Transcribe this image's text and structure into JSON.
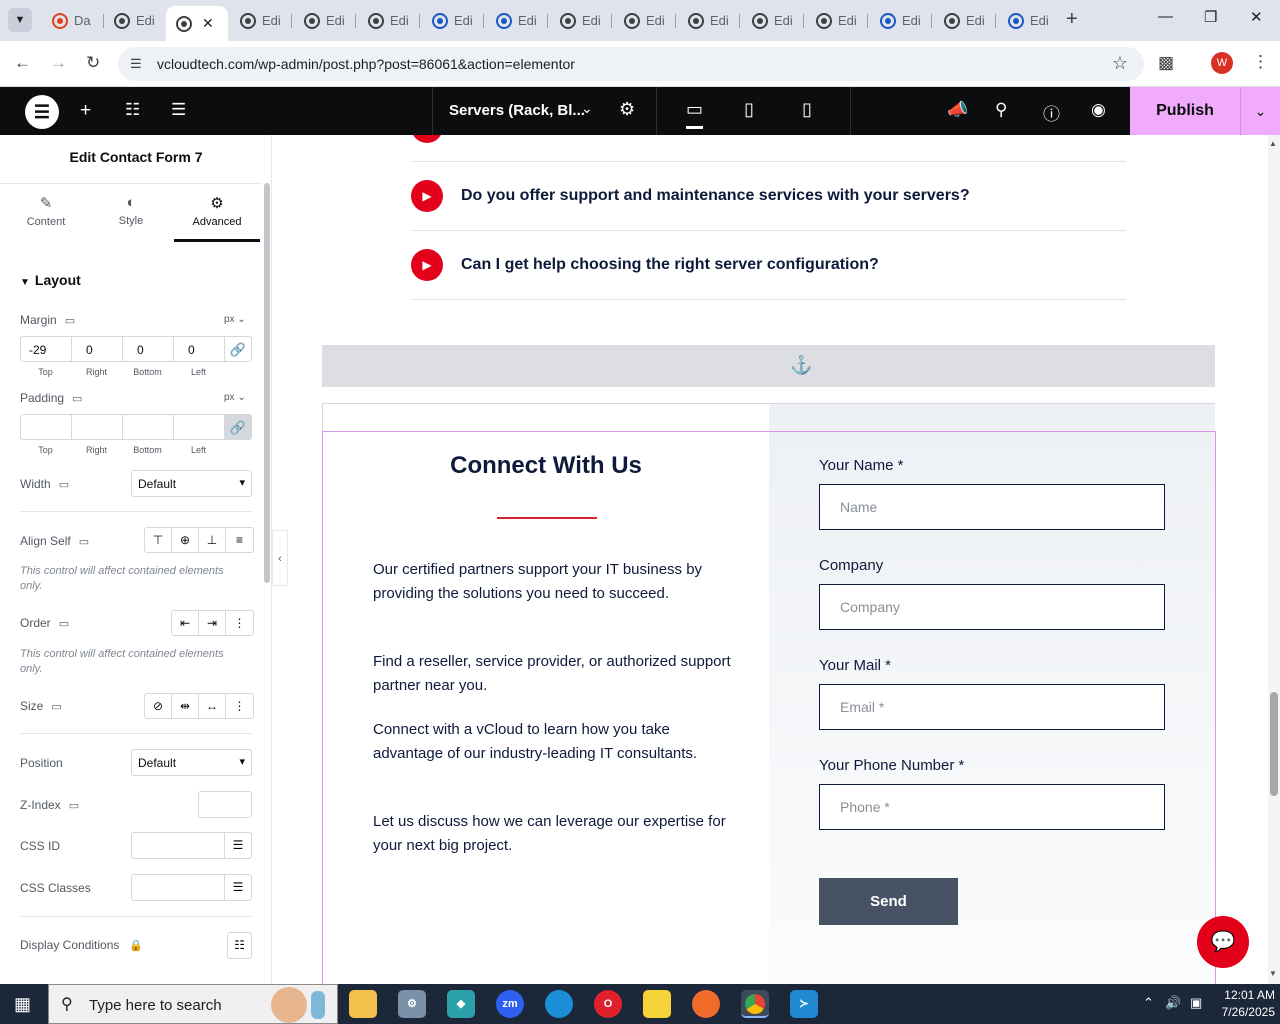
{
  "browser": {
    "tabs": [
      {
        "label": "Da",
        "favicon": "red"
      },
      {
        "label": "Edi",
        "favicon": "grey"
      },
      {
        "label": "",
        "favicon": "grey",
        "active": true
      },
      {
        "label": "Edi",
        "favicon": "grey"
      },
      {
        "label": "Edi",
        "favicon": "grey"
      },
      {
        "label": "Edi",
        "favicon": "grey"
      },
      {
        "label": "Edi",
        "favicon": "blue"
      },
      {
        "label": "Edi",
        "favicon": "blue"
      },
      {
        "label": "Edi",
        "favicon": "grey"
      },
      {
        "label": "Edi",
        "favicon": "grey"
      },
      {
        "label": "Edi",
        "favicon": "grey"
      },
      {
        "label": "Edi",
        "favicon": "grey"
      },
      {
        "label": "Edi",
        "favicon": "grey"
      },
      {
        "label": "Edi",
        "favicon": "blue"
      },
      {
        "label": "Edi",
        "favicon": "grey"
      },
      {
        "label": "Edi",
        "favicon": "blue"
      }
    ],
    "tab_close": "✕",
    "new_tab": "+",
    "url": "vcloudtech.com/wp-admin/post.php?post=86061&action=elementor",
    "profile_initial": "W"
  },
  "editor": {
    "document_title": "Servers (Rack, Bl...",
    "publish_label": "Publish",
    "accent_color": "#f0abfc"
  },
  "panel": {
    "title": "Edit Contact Form 7",
    "tabs": [
      "Content",
      "Style",
      "Advanced"
    ],
    "section": "Layout",
    "margin": {
      "label": "Margin",
      "unit": "px",
      "top": "-29",
      "right": "0",
      "bottom": "0",
      "left": "0"
    },
    "padding": {
      "label": "Padding",
      "unit": "px"
    },
    "sides": [
      "Top",
      "Right",
      "Bottom",
      "Left"
    ],
    "width": {
      "label": "Width",
      "value": "Default"
    },
    "align_self": {
      "label": "Align Self",
      "note": "This control will affect contained elements only."
    },
    "order": {
      "label": "Order",
      "note": "This control will affect contained elements only."
    },
    "size": {
      "label": "Size"
    },
    "position": {
      "label": "Position",
      "value": "Default"
    },
    "z_index": {
      "label": "Z-Index"
    },
    "css_id": {
      "label": "CSS ID"
    },
    "css_classes": {
      "label": "CSS Classes"
    },
    "display_conditions": {
      "label": "Display Conditions"
    }
  },
  "page": {
    "faq": [
      "Do you offer support and maintenance services with your servers?",
      "Can I get help choosing the right server configuration?"
    ],
    "connect": {
      "heading": "Connect With Us",
      "paragraphs": [
        "Our certified partners support your IT business by providing the solutions you need to succeed.",
        "Find a reseller, service provider, or authorized support partner near you.",
        "Connect with a vCloud to learn how you take advantage of our industry-leading IT consultants.",
        "Let us discuss how we can leverage our expertise for your next big project."
      ]
    },
    "form": {
      "fields": [
        {
          "label": "Your Name *",
          "placeholder": "Name"
        },
        {
          "label": "Company",
          "placeholder": "Company"
        },
        {
          "label": "Your Mail *",
          "placeholder": "Email *"
        },
        {
          "label": "Your Phone Number *",
          "placeholder": "Phone *"
        }
      ],
      "submit": "Send"
    },
    "brand_red": "#e3001b"
  },
  "taskbar": {
    "search_placeholder": "Type here to search",
    "apps": [
      "file-explorer",
      "settings",
      "3d-app",
      "zoom",
      "edge",
      "opera",
      "sticky-notes",
      "firefox",
      "chrome",
      "vscode"
    ],
    "zoom_label": "zm",
    "time": "12:01 AM",
    "date": "7/26/2025"
  }
}
